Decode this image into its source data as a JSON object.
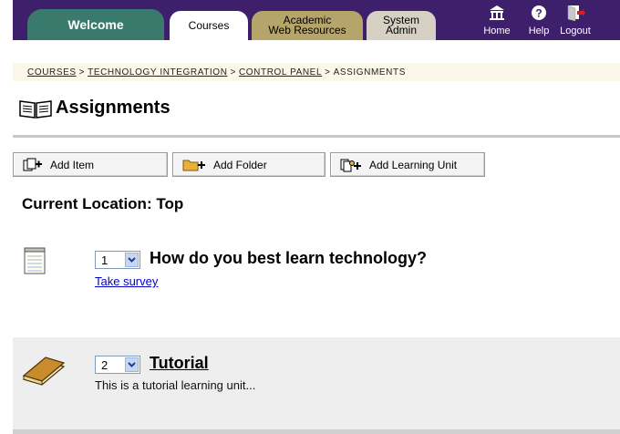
{
  "tabs": {
    "welcome": "Welcome",
    "courses": "Courses",
    "academic_line1": "Academic",
    "academic_line2": "Web Resources",
    "system_line1": "System",
    "system_line2": "Admin"
  },
  "nav": {
    "home": "Home",
    "help": "Help",
    "logout": "Logout"
  },
  "breadcrumb": {
    "items": [
      "COURSES",
      "TECHNOLOGY INTEGRATION",
      "CONTROL PANEL",
      "ASSIGNMENTS"
    ],
    "separator": ">"
  },
  "page_title": "Assignments",
  "buttons": {
    "add_item": "Add Item",
    "add_folder": "Add Folder",
    "add_learning_unit": "Add Learning Unit"
  },
  "current_location": "Current Location: Top",
  "items": [
    {
      "order": "1",
      "title": "How do you best learn technology?",
      "link": "Take survey",
      "icon": "survey-notepad-icon"
    },
    {
      "order": "2",
      "title": "Tutorial",
      "description": "This is a tutorial learning unit...",
      "icon": "book-icon"
    }
  ],
  "colors": {
    "topbar": "#3d1f6c",
    "welcome_tab": "#3a7a6c",
    "academic_tab": "#b5a56a",
    "system_tab": "#d6d1c3",
    "link": "#0000cc"
  }
}
